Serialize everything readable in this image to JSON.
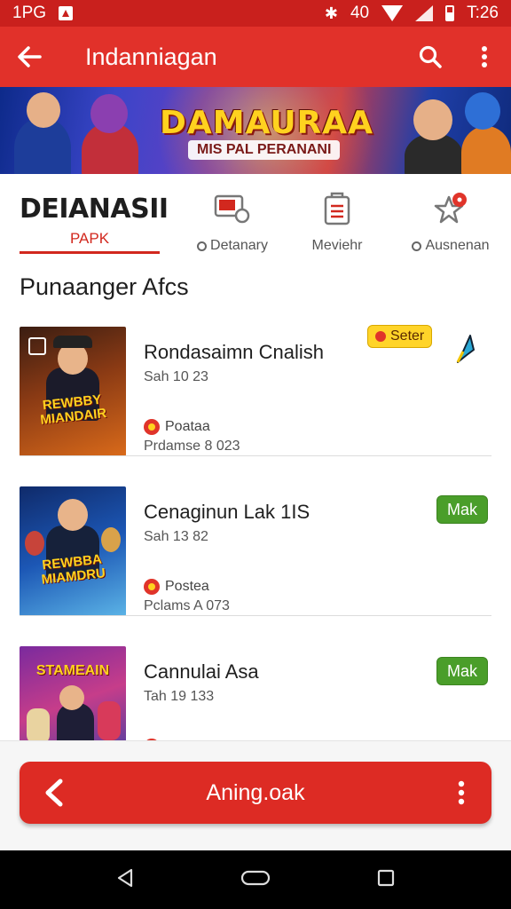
{
  "status_bar": {
    "left_text": "1PG",
    "network": "40",
    "time": "T:26",
    "icons": [
      "notification-icon",
      "bluetooth-icon",
      "wifi-icon",
      "signal-icon",
      "battery-icon"
    ]
  },
  "app_bar": {
    "title": "Indanniagan",
    "icons": [
      "back-arrow-icon",
      "search-icon",
      "more-vert-icon"
    ]
  },
  "banner": {
    "headline": "DAMAURAA",
    "subline": "MIS PAL PERANANI"
  },
  "tabs": {
    "brand": "DEIANASII",
    "brand_sub": "PAPK",
    "categories": [
      {
        "label": "Detanary",
        "icon": "tv-search-icon"
      },
      {
        "label": "Meviehr",
        "icon": "clipboard-icon"
      },
      {
        "label": "Ausnenan",
        "icon": "star-badge-icon",
        "badge": "•"
      }
    ]
  },
  "section_title": "Punaanger Afcs",
  "list": [
    {
      "title": "Rondasaimn Cnalish",
      "meta": "Sah 10 23",
      "tag": "Poataa",
      "sub": "Prdamse 8 023",
      "poster_text": "REWBBY MIANDAIR",
      "badge": "Seter",
      "side_icon": "pin-icon"
    },
    {
      "title": "Cenaginun Lak 1IS",
      "meta": "Sah 13 82",
      "tag": "Postea",
      "sub": "Pclams A 073",
      "poster_text": "REWBBA MIAMDRU",
      "action": "Mak"
    },
    {
      "title": "Cannulai Asa",
      "meta": "Tah 19 133",
      "poster_text": "STAMEAIN",
      "action": "Mak"
    }
  ],
  "bottom_bar": {
    "label": "Aning.oak"
  },
  "colors": {
    "primary": "#e1312a",
    "status": "#c9201d",
    "accent_yellow": "#ffd429",
    "accent_green": "#4a9e2a"
  }
}
